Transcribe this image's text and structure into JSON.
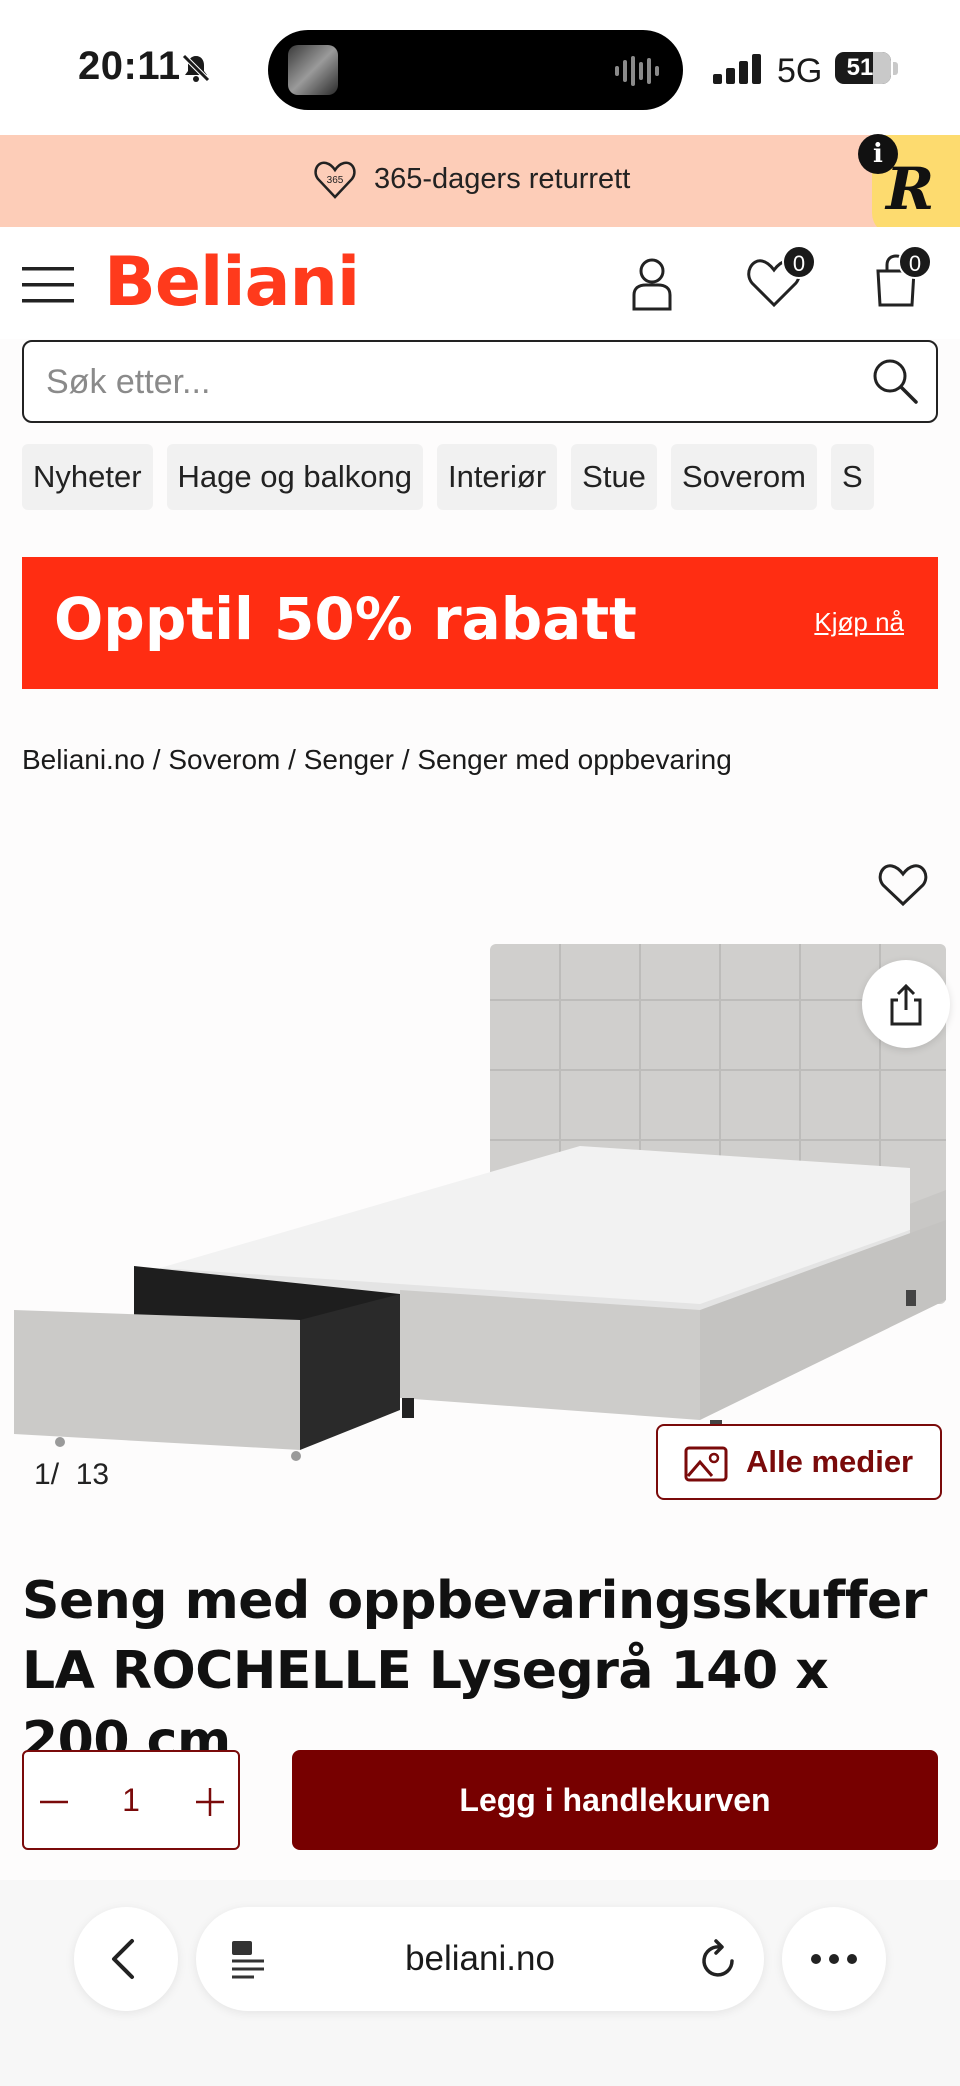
{
  "status_bar": {
    "time": "20:11",
    "network": "5G",
    "battery": "51"
  },
  "promo": {
    "text": "365-dagers returrett",
    "badge_icon_text": "365",
    "r_badge": "R",
    "info_badge": "i"
  },
  "header": {
    "logo": "Beliani",
    "wishlist_count": "0",
    "cart_count": "0"
  },
  "search": {
    "placeholder": "Søk etter..."
  },
  "categories": [
    "Nyheter",
    "Hage og balkong",
    "Interiør",
    "Stue",
    "Soverom",
    "S"
  ],
  "banner": {
    "headline": "Opptil 50% rabatt",
    "cta": "Kjøp nå"
  },
  "breadcrumb": "Beliani.no / Soverom / Senger / Senger med oppbevaring",
  "gallery": {
    "current": "1",
    "separator": "/",
    "total": "13",
    "all_media_label": "Alle medier"
  },
  "product": {
    "title": "Seng med oppbevaringsskuffer LA ROCHELLE Lysegrå 140 x 200 cm",
    "quantity": "1",
    "add_to_cart": "Legg i handlekurven"
  },
  "browser": {
    "url": "beliani.no"
  },
  "colors": {
    "brand": "#ff3a1c",
    "banner": "#ff2d12",
    "cart_button": "#770000",
    "promo_bg": "#fdcdb8"
  }
}
